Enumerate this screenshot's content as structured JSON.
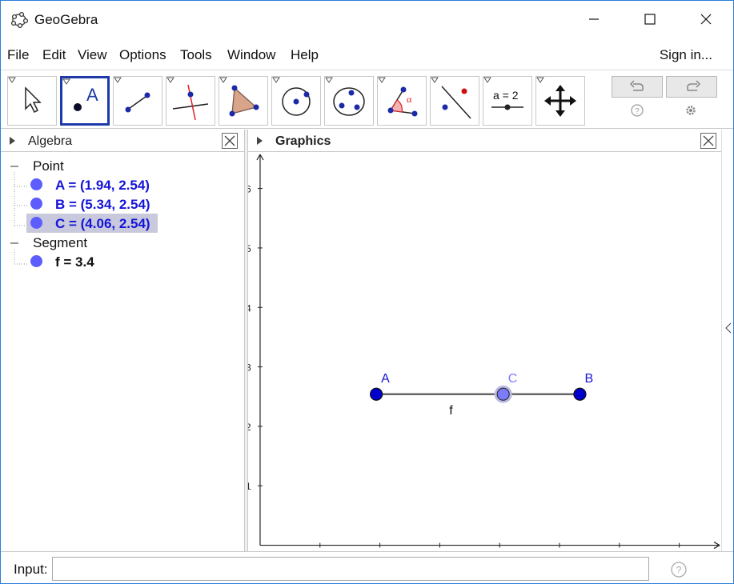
{
  "window": {
    "title": "GeoGebra",
    "icon": "geogebra-logo-icon",
    "controls": [
      "minimize-icon",
      "maximize-icon",
      "close-icon"
    ]
  },
  "menu": {
    "items": [
      "File",
      "Edit",
      "View",
      "Options",
      "Tools",
      "Window",
      "Help"
    ],
    "sign_in": "Sign in..."
  },
  "toolbar": {
    "tools": [
      {
        "name": "move-tool-icon",
        "selected": false
      },
      {
        "name": "point-tool-icon",
        "selected": true,
        "glyph": "A"
      },
      {
        "name": "line-tool-icon",
        "selected": false
      },
      {
        "name": "perpendicular-line-tool-icon",
        "selected": false
      },
      {
        "name": "polygon-tool-icon",
        "selected": false
      },
      {
        "name": "circle-center-point-tool-icon",
        "selected": false
      },
      {
        "name": "circle-three-points-tool-icon",
        "selected": false
      },
      {
        "name": "angle-tool-icon",
        "selected": false,
        "glyph": "α"
      },
      {
        "name": "reflect-tool-icon",
        "selected": false
      },
      {
        "name": "slider-tool-icon",
        "selected": false,
        "glyph": "a = 2"
      },
      {
        "name": "move-graphics-view-tool-icon",
        "selected": false
      }
    ],
    "undo_icon": "undo-icon",
    "redo_icon": "redo-icon",
    "help_icon": "help-icon",
    "settings_icon": "gear-icon"
  },
  "algebra": {
    "title": "Algebra",
    "groups": [
      {
        "label": "Point",
        "items": [
          {
            "text": "A = (1.94, 2.54)",
            "color": "#1414d8",
            "highlighted": false
          },
          {
            "text": "B = (5.34, 2.54)",
            "color": "#1414d8",
            "highlighted": false
          },
          {
            "text": "C = (4.06, 2.54)",
            "color": "#1414d8",
            "highlighted": true
          }
        ]
      },
      {
        "label": "Segment",
        "items": [
          {
            "text": "f = 3.4",
            "color": "#111111",
            "highlighted": false
          }
        ]
      }
    ]
  },
  "graphics": {
    "title": "Graphics",
    "y_ticks": [
      "1",
      "2",
      "3",
      "4",
      "5",
      "6"
    ],
    "points": [
      {
        "label": "A",
        "x": 1.94,
        "y": 2.54,
        "color": "#0000cc"
      },
      {
        "label": "B",
        "x": 5.34,
        "y": 2.54,
        "color": "#0000cc"
      },
      {
        "label": "C",
        "x": 4.06,
        "y": 2.54,
        "color": "#7c7cff"
      }
    ],
    "segment_label": "f",
    "x_range": [
      -0.2,
      7.7
    ],
    "y_range": [
      -0.1,
      6.6
    ]
  },
  "input": {
    "label": "Input:",
    "value": "",
    "placeholder": ""
  }
}
